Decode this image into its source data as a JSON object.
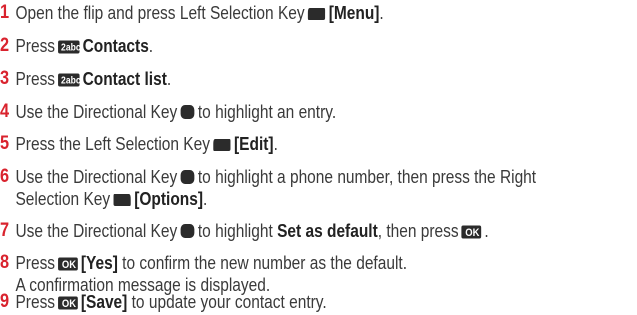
{
  "colors": {
    "step_number": "#d9232e",
    "text": "#3a3a3a",
    "key_icon": "#2b2b2b"
  },
  "icons": {
    "left_soft_key": "left-soft-key-icon",
    "right_soft_key": "right-soft-key-icon",
    "directional": "directional-key-icon",
    "ok": "ok-key-icon",
    "number_2": "number-2-key-icon"
  },
  "steps": [
    {
      "num": "1",
      "text": "Open the flip and press Left Selection Key",
      "bold": "[Menu]",
      "tail": "."
    },
    {
      "num": "2",
      "text": "Press",
      "bold": "Contacts",
      "tail": ".",
      "key_label": "2abc"
    },
    {
      "num": "3",
      "text": "Press",
      "bold": "Contact list",
      "tail": ".",
      "key_label": "2abc"
    },
    {
      "num": "4",
      "text": "Use the Directional Key",
      "tail": "to highlight an entry."
    },
    {
      "num": "5",
      "text": "Press the Left Selection Key",
      "bold": "[Edit]",
      "tail": "."
    },
    {
      "num": "6",
      "text": "Use the Directional Key",
      "tail": "to highlight a phone number, then press the Right",
      "line2": "Selection Key",
      "bold": "[Options]",
      "tail2": "."
    },
    {
      "num": "7",
      "text": "Use the Directional Key",
      "mid": "to highlight",
      "bold": "Set as default",
      "tail": ", then press",
      "tail2": "."
    },
    {
      "num": "8",
      "text": "Press",
      "bold": "[Yes]",
      "tail": "to confirm the new number as the default.",
      "line2": "A confirmation message is displayed."
    },
    {
      "num": "9",
      "text": "Press",
      "bold": "[Save]",
      "tail": "to update your contact entry."
    }
  ],
  "ok_label": "OK"
}
